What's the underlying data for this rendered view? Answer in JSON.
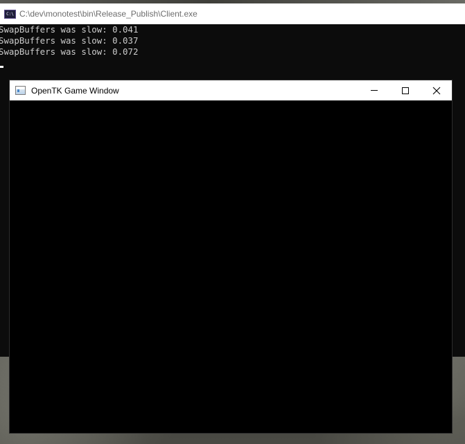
{
  "console": {
    "title": "C:\\dev\\monotest\\bin\\Release_Publish\\Client.exe",
    "icon": "console-app-icon",
    "icon_glyph": "C:\\",
    "lines": [
      "SwapBuffers was slow: 0.041",
      "SwapBuffers was slow: 0.037",
      "SwapBuffers was slow: 0.072"
    ]
  },
  "game_window": {
    "title": "OpenTK Game Window",
    "icon": "window-app-icon",
    "buttons": {
      "minimize": "minimize-icon",
      "maximize": "maximize-icon",
      "close": "close-icon"
    }
  },
  "colors": {
    "console_background": "#0c0c0c",
    "console_text": "#cccccc",
    "titlebar_background": "#ffffff",
    "game_canvas": "#000000"
  }
}
